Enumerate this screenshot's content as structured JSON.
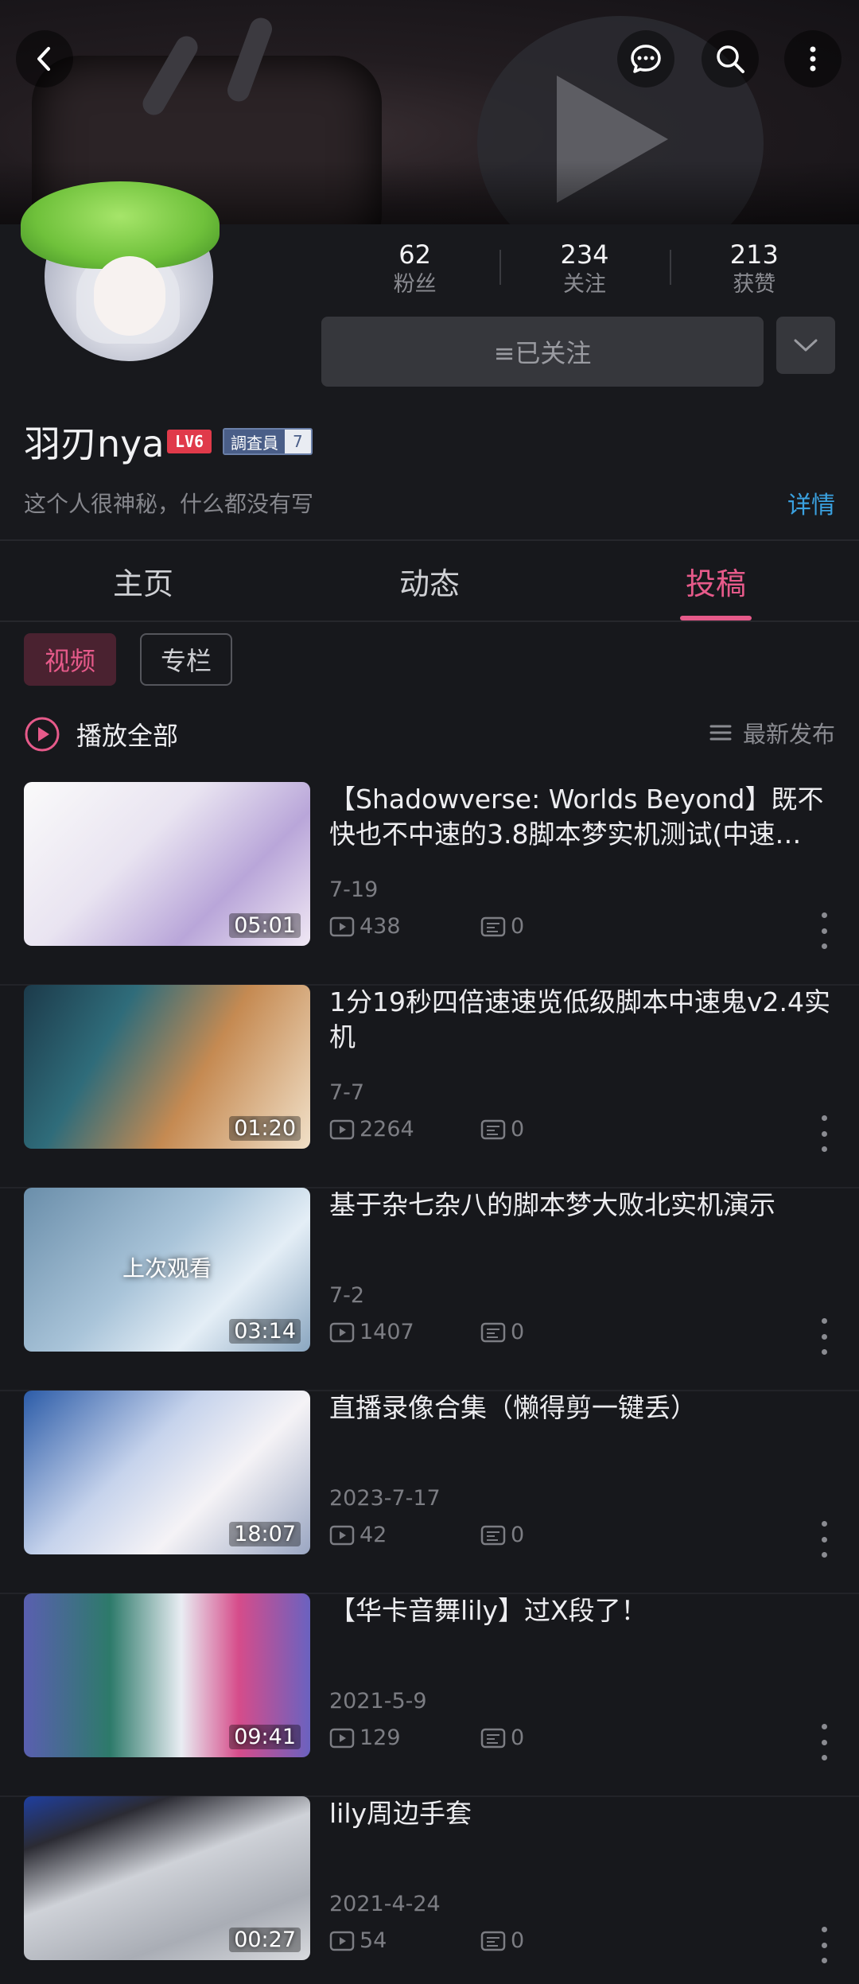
{
  "header": {
    "back_icon": "back-arrow-icon",
    "actions": [
      "chat-bubble-icon",
      "search-icon",
      "more-vertical-icon"
    ]
  },
  "profile": {
    "name": "羽刃nya",
    "level_badge": "LV6",
    "role_badge": "調査員",
    "role_level": "7",
    "bio": "这个人很神秘，什么都没有写",
    "detail_link": "详情",
    "stats": [
      {
        "num": "62",
        "label": "粉丝"
      },
      {
        "num": "234",
        "label": "关注"
      },
      {
        "num": "213",
        "label": "获赞"
      }
    ],
    "follow_label": "≡已关注"
  },
  "tabs": [
    {
      "label": "主页",
      "active": false
    },
    {
      "label": "动态",
      "active": false
    },
    {
      "label": "投稿",
      "active": true
    }
  ],
  "filters": {
    "video": "视频",
    "column": "专栏"
  },
  "list_header": {
    "play_all": "播放全部",
    "sort": "最新发布"
  },
  "videos": [
    {
      "title": "【Shadowverse: Worlds Beyond】既不快也不中速的3.8脚本梦实机测试(中速…",
      "date": "7-19",
      "plays": "438",
      "comments": "0",
      "duration": "05:01",
      "watched": ""
    },
    {
      "title": "1分19秒四倍速速览低级脚本中速鬼v2.4实机",
      "date": "7-7",
      "plays": "2264",
      "comments": "0",
      "duration": "01:20",
      "watched": ""
    },
    {
      "title": "基于杂七杂八的脚本梦大败北实机演示",
      "date": "7-2",
      "plays": "1407",
      "comments": "0",
      "duration": "03:14",
      "watched": "上次观看"
    },
    {
      "title": "直播录像合集（懒得剪一键丢）",
      "date": "2023-7-17",
      "plays": "42",
      "comments": "0",
      "duration": "18:07",
      "watched": ""
    },
    {
      "title": "【华卡音舞lily】过X段了！",
      "date": "2021-5-9",
      "plays": "129",
      "comments": "0",
      "duration": "09:41",
      "watched": ""
    },
    {
      "title": "lily周边手套",
      "date": "2021-4-24",
      "plays": "54",
      "comments": "0",
      "duration": "00:27",
      "watched": ""
    }
  ],
  "colors": {
    "accent": "#e65a8a",
    "link": "#3aa1e0",
    "background": "#17181c"
  }
}
